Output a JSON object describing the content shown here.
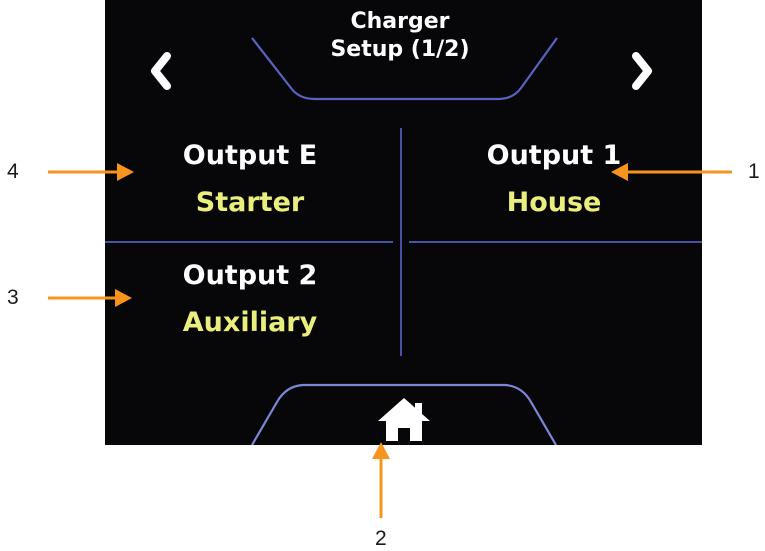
{
  "header": {
    "title_line1": "Charger",
    "title_line2": "Setup (1/2)"
  },
  "outputs": [
    {
      "name": "Output E",
      "role": "Starter"
    },
    {
      "name": "Output 1",
      "role": "House"
    },
    {
      "name": "Output 2",
      "role": "Auxiliary"
    }
  ],
  "callouts": {
    "one": "1",
    "two": "2",
    "three": "3",
    "four": "4"
  },
  "icons": {
    "prev": "chevron-left-icon",
    "next": "chevron-right-icon",
    "home": "home-icon"
  },
  "colors": {
    "screen_bg": "#070709",
    "divider": "#4a52a8",
    "label_white": "#ffffff",
    "label_yellow": "#e9ee7c",
    "arrow": "#f7941d"
  }
}
